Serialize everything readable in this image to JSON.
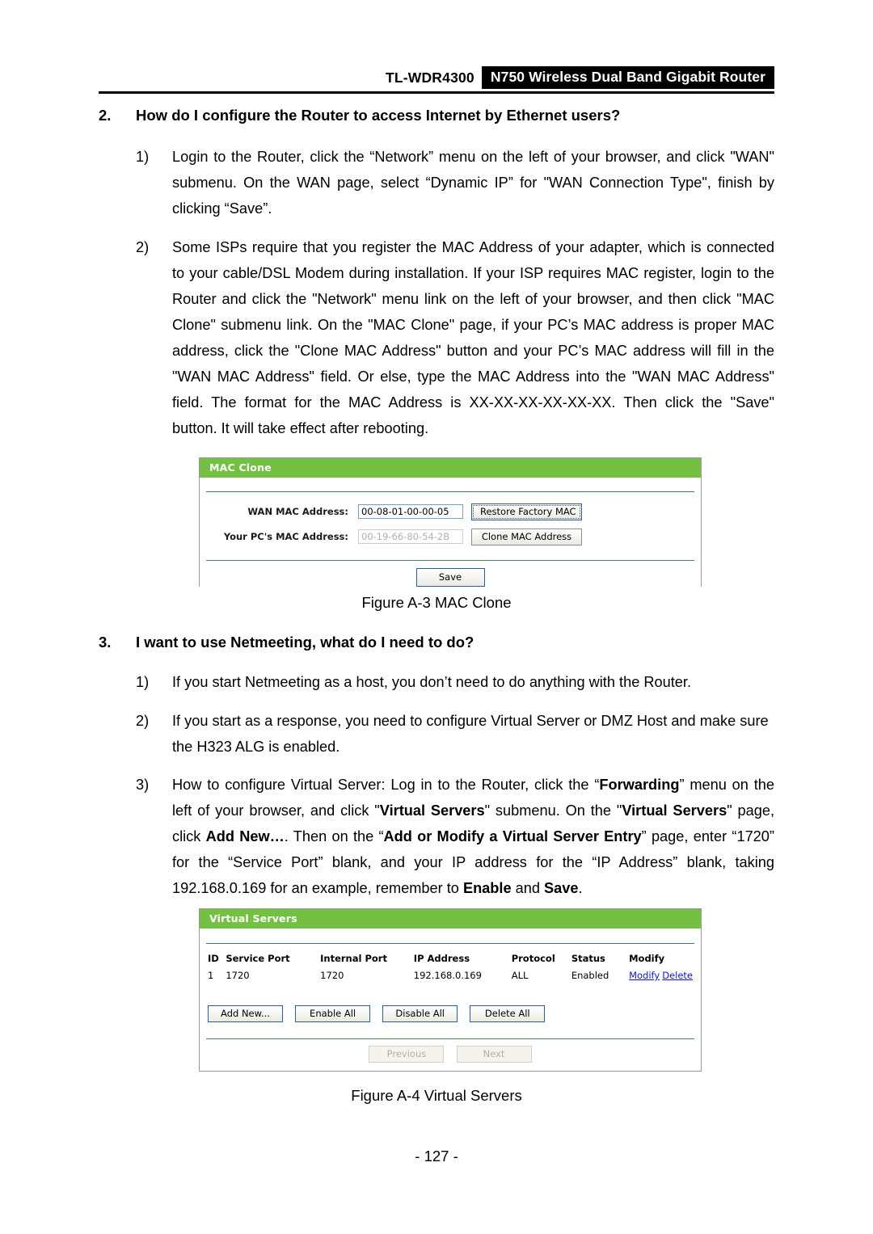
{
  "header": {
    "model": "TL-WDR4300",
    "product": "N750 Wireless Dual Band Gigabit Router"
  },
  "sections": [
    {
      "number": "2.",
      "heading": "How do I configure the Router to access Internet by Ethernet users?",
      "items": [
        {
          "number": "1)",
          "text": "Login to the Router, click the “Network” menu on the left of your browser, and click \"WAN\" submenu. On the WAN page, select “Dynamic IP” for \"WAN Connection Type\", finish by clicking “Save”."
        },
        {
          "number": "2)",
          "text": "Some ISPs require that you register the MAC Address of your adapter, which is connected to your cable/DSL Modem during installation. If your ISP requires MAC register, login to the Router and click the \"Network\" menu link on the left of your browser, and then click \"MAC Clone\" submenu link. On the \"MAC Clone\" page, if your PC’s MAC address is proper MAC address, click the \"Clone MAC Address\" button and your PC’s MAC address will fill in the \"WAN MAC Address\" field. Or else, type the MAC Address into the \"WAN MAC Address\" field. The format for the MAC Address is XX-XX-XX-XX-XX-XX. Then click the \"Save\" button. It will take effect after rebooting."
        }
      ]
    },
    {
      "number": "3.",
      "heading": "I want to use Netmeeting, what do I need to do?",
      "items": [
        {
          "number": "1)",
          "text": "If you start Netmeeting as a host, you don’t need to do anything with the Router."
        },
        {
          "number": "2)",
          "text": "If you start as a response, you need to configure Virtual Server or DMZ Host and make sure the H323 ALG is enabled."
        },
        {
          "number": "3)",
          "text_html": "How to configure Virtual Server: Log in to the Router, click the “<b>Forwarding</b>” menu on the left of your browser, and click \"<b>Virtual Servers</b>\" submenu. On the \"<b>Virtual Servers</b>\" page, click <b>Add New…</b>. Then on the “<b>Add or Modify a Virtual Server Entry</b>” page, enter “1720” for the “Service Port” blank, and your IP address for the “IP Address” blank, taking 192.168.0.169 for an example, remember to <b>Enable</b> and <b>Save</b>."
        }
      ]
    }
  ],
  "mac_clone_panel": {
    "title": "MAC Clone",
    "wan_mac_label": "WAN MAC Address:",
    "wan_mac_value": "00-08-01-00-00-05",
    "restore_button": "Restore Factory MAC",
    "pc_mac_label": "Your PC's MAC Address:",
    "pc_mac_value": "00-19-66-80-54-2B",
    "clone_button": "Clone MAC Address",
    "save_button": "Save"
  },
  "figure_a3_caption": "Figure A-3 MAC Clone",
  "virtual_servers_panel": {
    "title": "Virtual Servers",
    "columns": [
      "ID",
      "Service Port",
      "Internal Port",
      "IP Address",
      "Protocol",
      "Status",
      "Modify"
    ],
    "rows": [
      {
        "id": "1",
        "service_port": "1720",
        "internal_port": "1720",
        "ip_address": "192.168.0.169",
        "protocol": "ALL",
        "status": "Enabled",
        "modify_link": "Modify",
        "delete_link": "Delete"
      }
    ],
    "buttons": [
      "Add New...",
      "Enable All",
      "Disable All",
      "Delete All"
    ],
    "pagination": {
      "previous": "Previous",
      "next": "Next"
    }
  },
  "figure_a4_caption": "Figure A-4 Virtual Servers",
  "page_number": "- 127 -",
  "colors": {
    "panel_green": "#74c043",
    "link_blue": "#1414c8",
    "header_black": "#000000"
  }
}
